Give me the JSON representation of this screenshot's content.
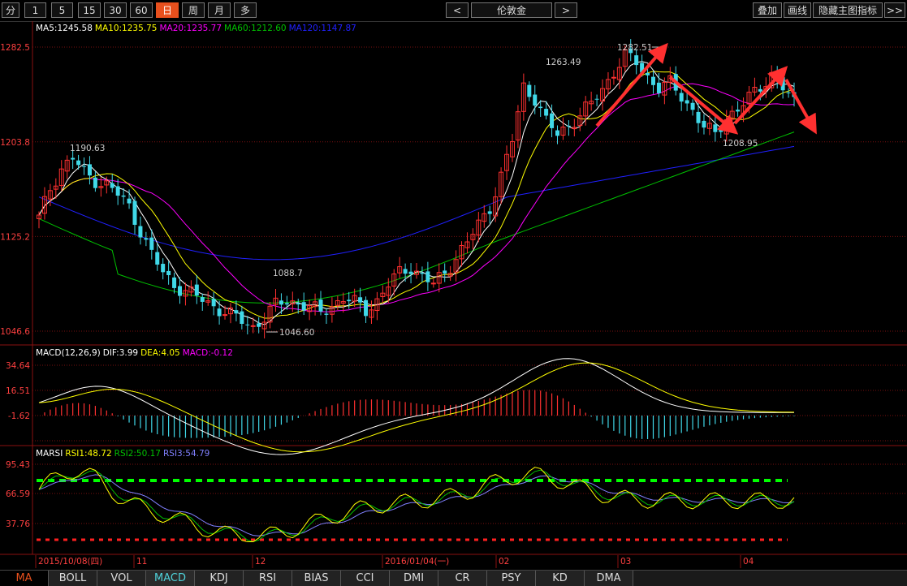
{
  "toolbar": {
    "periods": [
      "分",
      "1",
      "5",
      "15",
      "30",
      "60",
      "日",
      "周",
      "月",
      "多"
    ],
    "active_period": "日",
    "prev": "<",
    "next": ">",
    "symbol": "伦敦金",
    "right_buttons": [
      "叠加",
      "画线",
      "隐藏主图指标",
      ">>"
    ]
  },
  "main": {
    "ma_legend": [
      {
        "label": "MA5:1245.58",
        "color": "#ffffff"
      },
      {
        "label": "MA10:1235.75",
        "color": "#ffff00"
      },
      {
        "label": "MA20:1235.77",
        "color": "#ff00ff"
      },
      {
        "label": "MA60:1212.60",
        "color": "#00c000"
      },
      {
        "label": "MA120:1147.87",
        "color": "#2020ff"
      }
    ],
    "y_ticks": [
      "1282.5",
      "1203.8",
      "1125.2",
      "1046.6"
    ],
    "annotations": [
      "1190.63",
      "1088.7",
      "1046.60",
      "1263.49",
      "1282.51",
      "1208.95"
    ]
  },
  "macd": {
    "legend": [
      {
        "label": "MACD(12,26,9)",
        "color": "#ffffff"
      },
      {
        "label": "DIF:3.99",
        "color": "#ffffff"
      },
      {
        "label": "DEA:4.05",
        "color": "#ffff00"
      },
      {
        "label": "MACD:-0.12",
        "color": "#ff00ff"
      }
    ],
    "y_ticks": [
      "34.64",
      "16.51",
      "-1.62"
    ]
  },
  "rsi": {
    "legend": [
      {
        "label": "MARSI",
        "color": "#ffffff"
      },
      {
        "label": "RSI1:48.72",
        "color": "#ffff00"
      },
      {
        "label": "RSI2:50.17",
        "color": "#00c000"
      },
      {
        "label": "RSI3:54.79",
        "color": "#8080ff"
      }
    ],
    "y_ticks": [
      "95.43",
      "66.59",
      "37.76"
    ]
  },
  "x_axis": [
    "2015/10/08(四)",
    "11",
    "12",
    "2016/01/04(一)",
    "02",
    "03",
    "04"
  ],
  "bottom_tabs": [
    "MA",
    "BOLL",
    "VOL",
    "MACD",
    "KDJ",
    "RSI",
    "BIAS",
    "CCI",
    "DMI",
    "CR",
    "PSY",
    "KD",
    "DMA"
  ],
  "colors": {
    "up": "#ff3030",
    "down": "#40d8e8",
    "arrow": "#ff3030",
    "grid": "#7a1010"
  },
  "chart_data": {
    "type": "candlestick",
    "y_range": [
      1046.6,
      1282.5
    ],
    "close_path": [
      1140,
      1165,
      1182,
      1190,
      1178,
      1172,
      1168,
      1160,
      1150,
      1130,
      1110,
      1095,
      1085,
      1080,
      1075,
      1070,
      1065,
      1060,
      1055,
      1050,
      1058,
      1068,
      1072,
      1070,
      1066,
      1062,
      1068,
      1074,
      1070,
      1064,
      1072,
      1085,
      1095,
      1100,
      1092,
      1085,
      1095,
      1108,
      1120,
      1135,
      1150,
      1175,
      1205,
      1250,
      1240,
      1220,
      1210,
      1218,
      1226,
      1235,
      1248,
      1262,
      1275,
      1270,
      1258,
      1248,
      1252,
      1242,
      1230,
      1215,
      1210,
      1225,
      1230,
      1240,
      1250,
      1260,
      1248,
      1236
    ],
    "ma120_end": 1147.87,
    "ma60_end": 1212.6
  }
}
